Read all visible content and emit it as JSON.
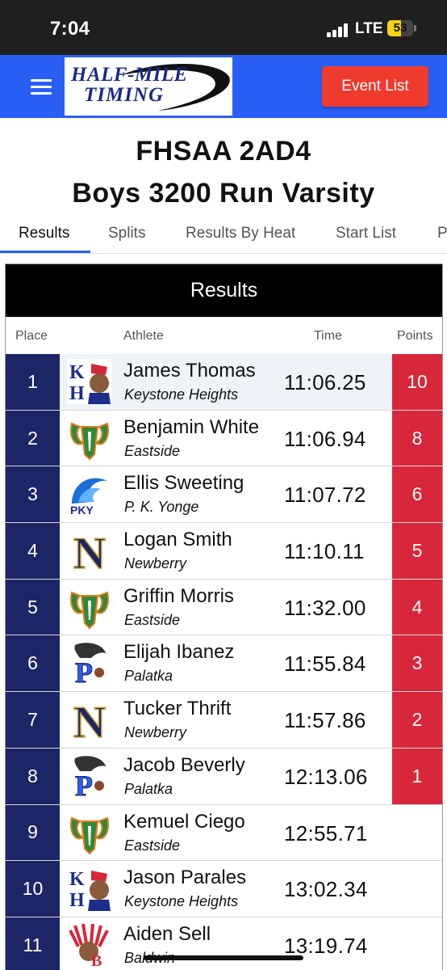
{
  "status_bar": {
    "time": "7:04",
    "network": "LTE",
    "battery": "53",
    "battery_level": 0.53
  },
  "header": {
    "logo_line1": "HALF-MILE",
    "logo_line2": "TIMING",
    "event_list_button": "Event List"
  },
  "meet_title": "FHSAA 2AD4",
  "event_title": "Boys 3200 Run Varsity",
  "tabs": [
    {
      "label": "Results",
      "active": true
    },
    {
      "label": "Splits",
      "active": false
    },
    {
      "label": "Results By Heat",
      "active": false
    },
    {
      "label": "Start List",
      "active": false
    },
    {
      "label": "P",
      "active": false
    }
  ],
  "results": {
    "heading": "Results",
    "columns": {
      "place": "Place",
      "athlete": "Athlete",
      "time": "Time",
      "points": "Points"
    },
    "rows": [
      {
        "place": "1",
        "name": "James Thomas",
        "team": "Keystone Heights",
        "time": "11:06.25",
        "points": "10",
        "logo": "kh-logo-icon"
      },
      {
        "place": "2",
        "name": "Benjamin White",
        "team": "Eastside",
        "time": "11:06.94",
        "points": "8",
        "logo": "ram-logo-icon"
      },
      {
        "place": "3",
        "name": "Ellis Sweeting",
        "team": "P. K. Yonge",
        "time": "11:07.72",
        "points": "6",
        "logo": "pky-wave-logo-icon"
      },
      {
        "place": "4",
        "name": "Logan Smith",
        "team": "Newberry",
        "time": "11:10.11",
        "points": "5",
        "logo": "newberry-n-logo-icon"
      },
      {
        "place": "5",
        "name": "Griffin Morris",
        "team": "Eastside",
        "time": "11:32.00",
        "points": "4",
        "logo": "ram-logo-icon"
      },
      {
        "place": "6",
        "name": "Elijah Ibanez",
        "team": "Palatka",
        "time": "11:55.84",
        "points": "3",
        "logo": "palatka-panther-logo-icon"
      },
      {
        "place": "7",
        "name": "Tucker Thrift",
        "team": "Newberry",
        "time": "11:57.86",
        "points": "2",
        "logo": "newberry-n-logo-icon"
      },
      {
        "place": "8",
        "name": "Jacob Beverly",
        "team": "Palatka",
        "time": "12:13.06",
        "points": "1",
        "logo": "palatka-panther-logo-icon"
      },
      {
        "place": "9",
        "name": "Kemuel Ciego",
        "team": "Eastside",
        "time": "12:55.71",
        "points": "",
        "logo": "ram-logo-icon"
      },
      {
        "place": "10",
        "name": "Jason Parales",
        "team": "Keystone Heights",
        "time": "13:02.34",
        "points": "",
        "logo": "kh-logo-icon"
      },
      {
        "place": "11",
        "name": "Aiden Sell",
        "team": "Baldwin",
        "time": "13:19.74",
        "points": "",
        "logo": "baldwin-indian-logo-icon"
      }
    ]
  },
  "colors": {
    "header_blue": "#2a5ff5",
    "button_red": "#ef3b2d",
    "place_navy": "#1c2566",
    "points_red": "#d8263a",
    "card_header": "#000000"
  }
}
